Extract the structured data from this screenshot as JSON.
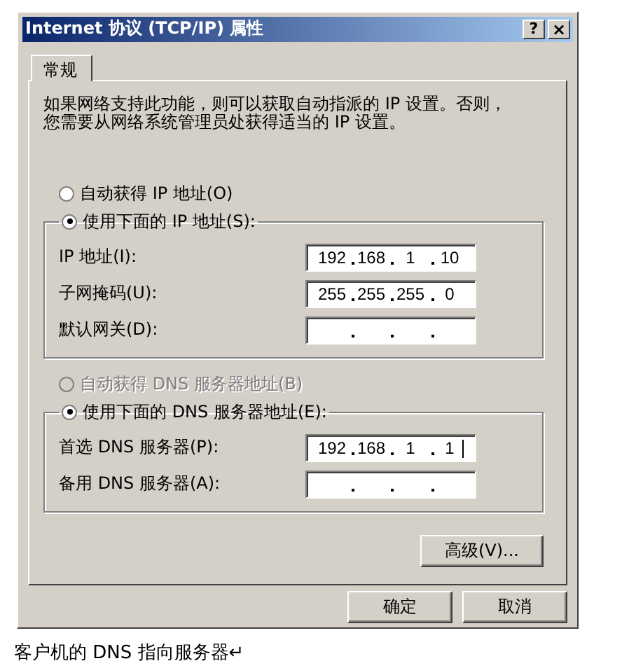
{
  "window": {
    "title": "Internet 协议 (TCP/IP) 属性",
    "controls": [
      {
        "kind": "help",
        "label": "?"
      },
      {
        "kind": "close",
        "label": "×"
      }
    ]
  },
  "tabs": [
    {
      "label": "常规",
      "selected": true
    }
  ],
  "description": "如果网络支持此功能，则可以获取自动指派的 IP 设置。否则，您需要从网络系统管理员处获得适当的 IP 设置。",
  "sections": [
    {
      "auto_option": {
        "label": "自动获得 IP 地址(O)",
        "selected": false,
        "disabled": false
      },
      "manual_group": {
        "label": "使用下面的 IP 地址(S):",
        "selected": true,
        "disabled": false,
        "fields": [
          {
            "label": "IP 地址(I):",
            "octets": [
              "192",
              "168",
              "1",
              "10"
            ],
            "focused": false
          },
          {
            "label": "子网掩码(U):",
            "octets": [
              "255",
              "255",
              "255",
              "0"
            ],
            "focused": false
          },
          {
            "label": "默认网关(D):",
            "focused": false
          }
        ]
      }
    },
    {
      "auto_option": {
        "label": "自动获得 DNS 服务器地址(B)",
        "selected": false,
        "disabled": true
      },
      "manual_group": {
        "label": "使用下面的 DNS 服务器地址(E):",
        "selected": true,
        "disabled": false,
        "fields": [
          {
            "label": "首选 DNS 服务器(P):",
            "octets": [
              "192",
              "168",
              "1",
              "1"
            ],
            "focused": true
          },
          {
            "label": "备用 DNS 服务器(A):",
            "focused": false
          }
        ]
      }
    }
  ],
  "advanced_button": "高级(V)...",
  "buttons": [
    "确定",
    "取消"
  ],
  "caption": "客户机的 DNS 指向服务器↵"
}
